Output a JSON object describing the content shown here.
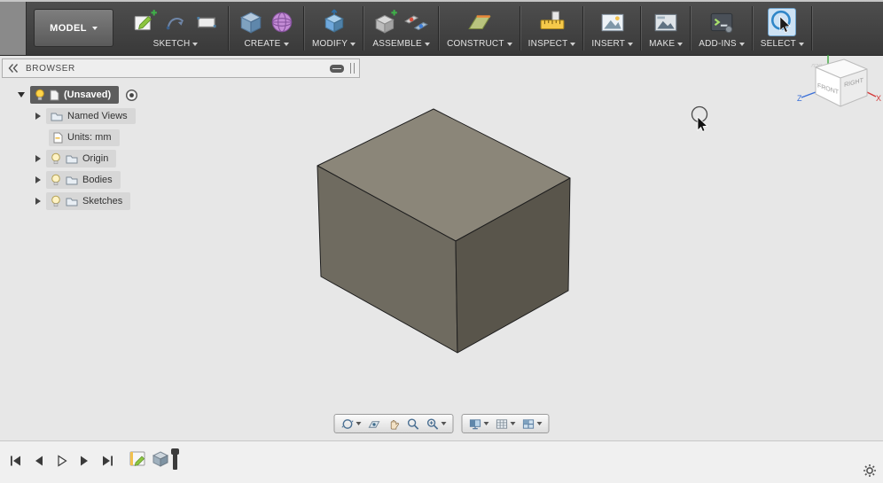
{
  "toolbar": {
    "workspace": "MODEL",
    "groups": [
      {
        "label": "SKETCH"
      },
      {
        "label": "CREATE"
      },
      {
        "label": "MODIFY"
      },
      {
        "label": "ASSEMBLE"
      },
      {
        "label": "CONSTRUCT"
      },
      {
        "label": "INSPECT"
      },
      {
        "label": "INSERT"
      },
      {
        "label": "MAKE"
      },
      {
        "label": "ADD-INS"
      },
      {
        "label": "SELECT"
      }
    ]
  },
  "browser": {
    "title": "BROWSER",
    "root_item": "(Unsaved)",
    "items": [
      {
        "label": "Named Views"
      },
      {
        "label": "Units: mm"
      },
      {
        "label": "Origin"
      },
      {
        "label": "Bodies"
      },
      {
        "label": "Sketches"
      }
    ]
  },
  "viewcube": {
    "front": "FRONT",
    "right": "RIGHT",
    "top": "TOP",
    "x": "X",
    "z": "Z"
  },
  "colors": {
    "toolbar_bg": "#424242",
    "canvas_bg": "#e7e7e7",
    "select_active_bg": "#cde2f4",
    "box_top": "#8b8679",
    "box_front": "#6f6b60",
    "box_right": "#59554b",
    "selected_row_bg": "#5d5d5d"
  }
}
